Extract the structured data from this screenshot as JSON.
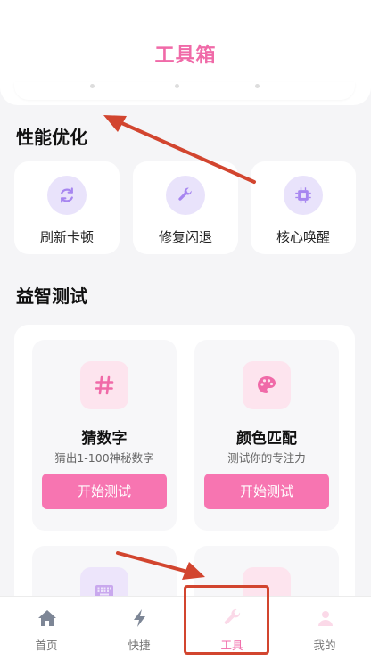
{
  "header": {
    "title": "工具箱"
  },
  "sections": {
    "performance": {
      "title": "性能优化",
      "items": [
        {
          "label": "刷新卡顿",
          "icon": "refresh-icon"
        },
        {
          "label": "修复闪退",
          "icon": "wrench-icon"
        },
        {
          "label": "核心唤醒",
          "icon": "chip-icon"
        }
      ]
    },
    "puzzle": {
      "title": "益智测试",
      "games": [
        {
          "title": "猜数字",
          "desc": "猜出1-100神秘数字",
          "button": "开始测试",
          "icon": "hash-icon"
        },
        {
          "title": "颜色匹配",
          "desc": "测试你的专注力",
          "button": "开始测试",
          "icon": "palette-icon"
        },
        {
          "icon": "keyboard-icon"
        },
        {
          "icon": "game-icon"
        }
      ]
    }
  },
  "tabbar": {
    "items": [
      {
        "label": "首页",
        "icon": "home-icon"
      },
      {
        "label": "快捷",
        "icon": "lightning-icon"
      },
      {
        "label": "工具",
        "icon": "tools-icon",
        "active": true
      },
      {
        "label": "我的",
        "icon": "profile-icon"
      }
    ]
  },
  "colors": {
    "accent": "#f06aa8",
    "button": "#f775b1",
    "perf_icon_bg": "#e9e3fb",
    "perf_icon": "#a786f0",
    "game_icon_bg": "#fde4ee",
    "annotation": "#d2452f"
  }
}
